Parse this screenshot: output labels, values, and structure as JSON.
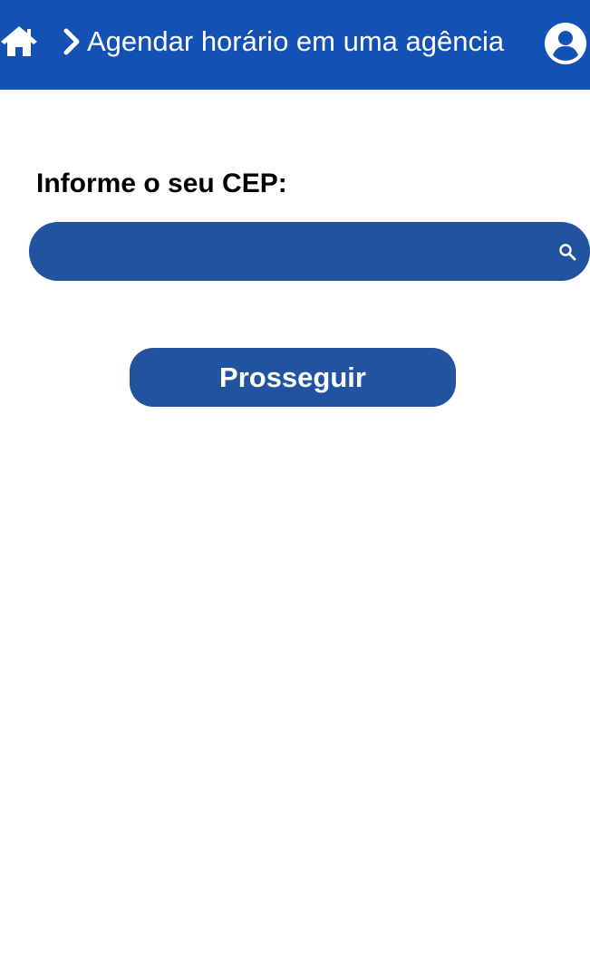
{
  "header": {
    "title": "Agendar horário em uma agência",
    "background": "#1351b4",
    "icons": [
      "home-icon",
      "chevron-right-icon",
      "user-circle-icon"
    ]
  },
  "form": {
    "cep_label": "Informe o seu CEP:",
    "cep_value": "",
    "cep_placeholder": "",
    "search_icon": "search-icon",
    "proceed_label": "Prosseguir",
    "accent": "#2153a0"
  }
}
